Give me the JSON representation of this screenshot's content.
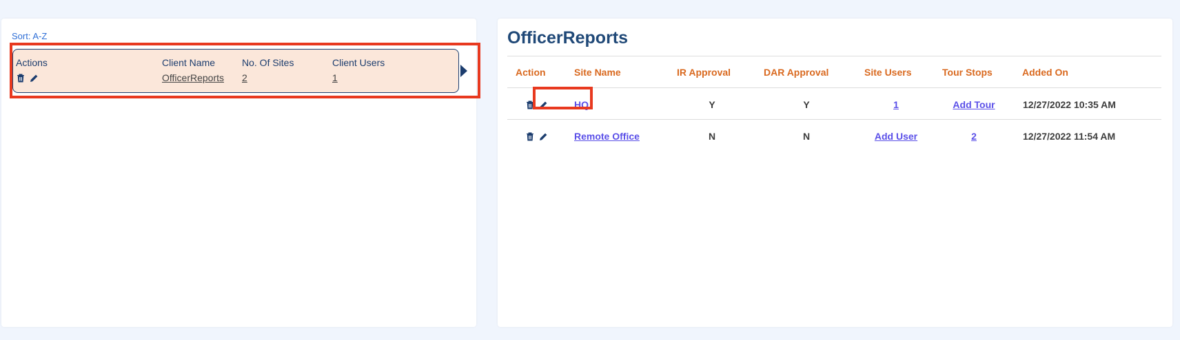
{
  "left": {
    "sort_label": "Sort: A-Z",
    "card": {
      "headers": [
        "Actions",
        "Client Name",
        "No. Of Sites",
        "Client Users"
      ],
      "client_name": "OfficerReports",
      "num_sites": "2",
      "client_users": "1",
      "icons": [
        "trash-icon",
        "pencil-icon"
      ]
    }
  },
  "right": {
    "title": "OfficerReports",
    "headers": [
      "Action",
      "Site Name",
      "IR Approval",
      "DAR Approval",
      "Site Users",
      "Tour Stops",
      "Added On"
    ],
    "rows": [
      {
        "site_name": "HQ",
        "ir": "Y",
        "dar": "Y",
        "site_users": "1",
        "tour_stops": "Add Tour",
        "added_on": "12/27/2022 10:35 AM"
      },
      {
        "site_name": "Remote Office",
        "ir": "N",
        "dar": "N",
        "site_users": "Add User",
        "tour_stops": "2",
        "added_on": "12/27/2022 11:54 AM"
      }
    ]
  },
  "colors": {
    "accent_header": "#d9691f",
    "title": "#1f4877",
    "link": "#5a4fe8",
    "highlight": "#e8391f",
    "card_bg": "#fbe7da"
  }
}
